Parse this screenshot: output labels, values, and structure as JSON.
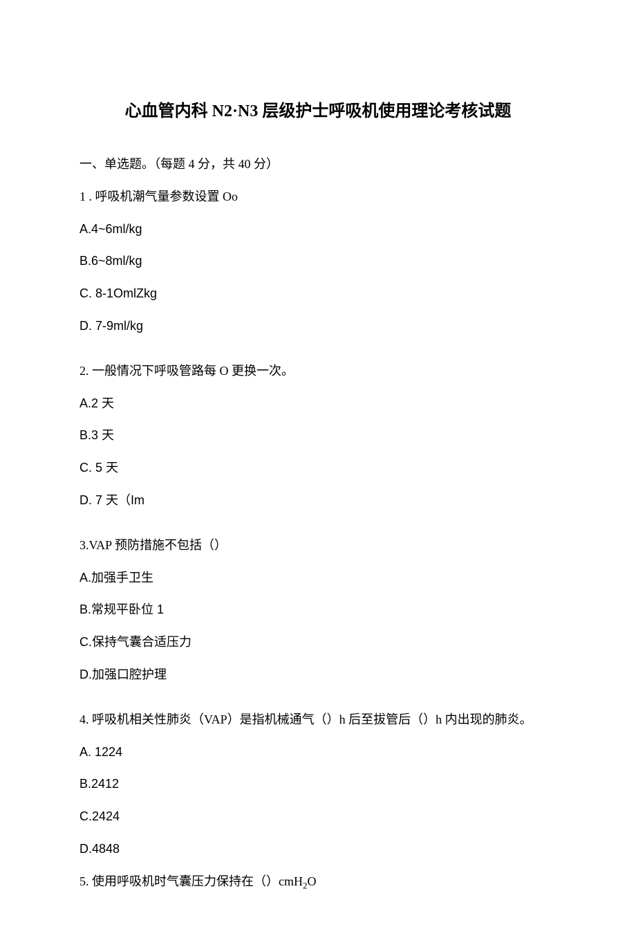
{
  "title": "心血管内科 N2·N3 层级护士呼吸机使用理论考核试题",
  "sectionHeader": "一、单选题。（每题 4 分，共 40 分）",
  "q1": {
    "text": "1 . 呼吸机潮气量参数设置 Oo",
    "a": "A.4~6ml/kg",
    "b": "B.6~8ml/kg",
    "c": "C.   8-1OmlZkg",
    "d": "D.   7-9ml/kg"
  },
  "q2": {
    "text": "2. 一般情况下呼吸管路每 O 更换一次。",
    "a": "A.2 天",
    "b": "B.3 天",
    "c": "C.   5 天",
    "d": "D.   7 天（Im"
  },
  "q3": {
    "text": "3.VAP 预防措施不包括（）",
    "a": "A.加强手卫生",
    "b": "B.常规平卧位 1",
    "c": "C.保持气囊合适压力",
    "d": "D.加强口腔护理"
  },
  "q4": {
    "text": "4. 呼吸机相关性肺炎（VAP）是指机械通气（）h 后至拔管后（）h 内出现的肺炎。",
    "a": "A.    1224",
    "b": "B.2412",
    "c": "C.2424",
    "d": "D.4848"
  },
  "q5": {
    "prefix": "5. 使用呼吸机时气囊压力保持在（）cmH",
    "sub": "2",
    "suffix": "O"
  }
}
